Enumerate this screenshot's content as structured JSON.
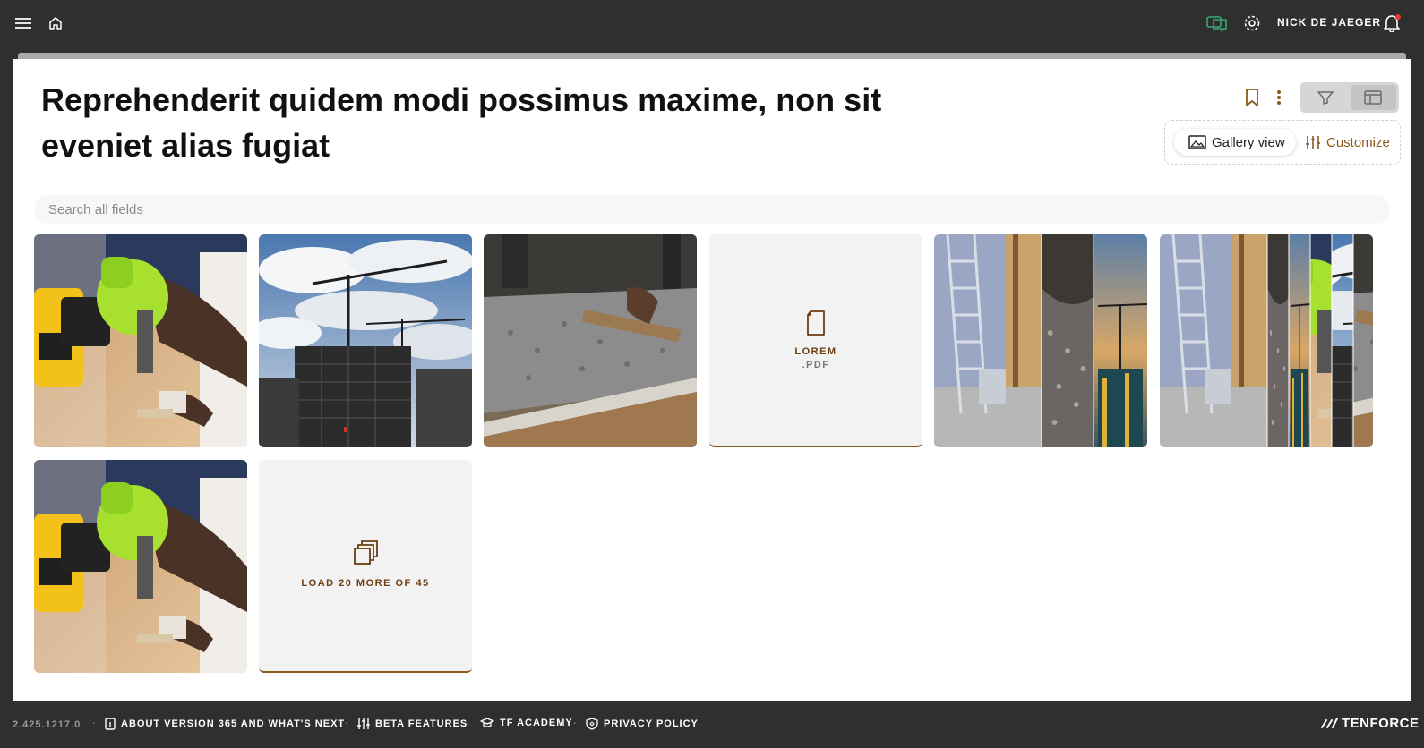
{
  "topbar": {
    "user_name": "NICK DE JAEGER",
    "icons": [
      "menu-icon",
      "home-icon",
      "chat-icon",
      "settings-icon",
      "bell-icon"
    ],
    "accent_color": "#3aa775",
    "notification_dot_color": "#e53935"
  },
  "page": {
    "title": "Reprehenderit quidem modi possimus maxime, non sit eveniet alias fugiat",
    "search_placeholder": "Search all fields",
    "gallery_view_label": "Gallery view",
    "customize_label": "Customize",
    "accent_color": "#8a5a1a"
  },
  "gallery": {
    "tiles": [
      {
        "type": "image",
        "subject": "drill"
      },
      {
        "type": "image",
        "subject": "cranes"
      },
      {
        "type": "image",
        "subject": "concrete"
      },
      {
        "type": "document",
        "name": "LOREM",
        "extension": ".PDF"
      },
      {
        "type": "image",
        "subject": "collage-3"
      },
      {
        "type": "image",
        "subject": "collage-6"
      },
      {
        "type": "image",
        "subject": "drill"
      }
    ],
    "load_more_label": "LOAD 20 MORE OF 45"
  },
  "footer": {
    "version": "2.425.1217.0",
    "links": [
      {
        "label": "ABOUT VERSION 365 AND WHAT'S NEXT",
        "icon": "info-icon"
      },
      {
        "label": "BETA FEATURES",
        "icon": "sliders-icon"
      },
      {
        "label": "TF ACADEMY",
        "icon": "graduation-cap-icon"
      },
      {
        "label": "PRIVACY POLICY",
        "icon": "shield-icon"
      }
    ],
    "brand": "TENFORCE"
  }
}
